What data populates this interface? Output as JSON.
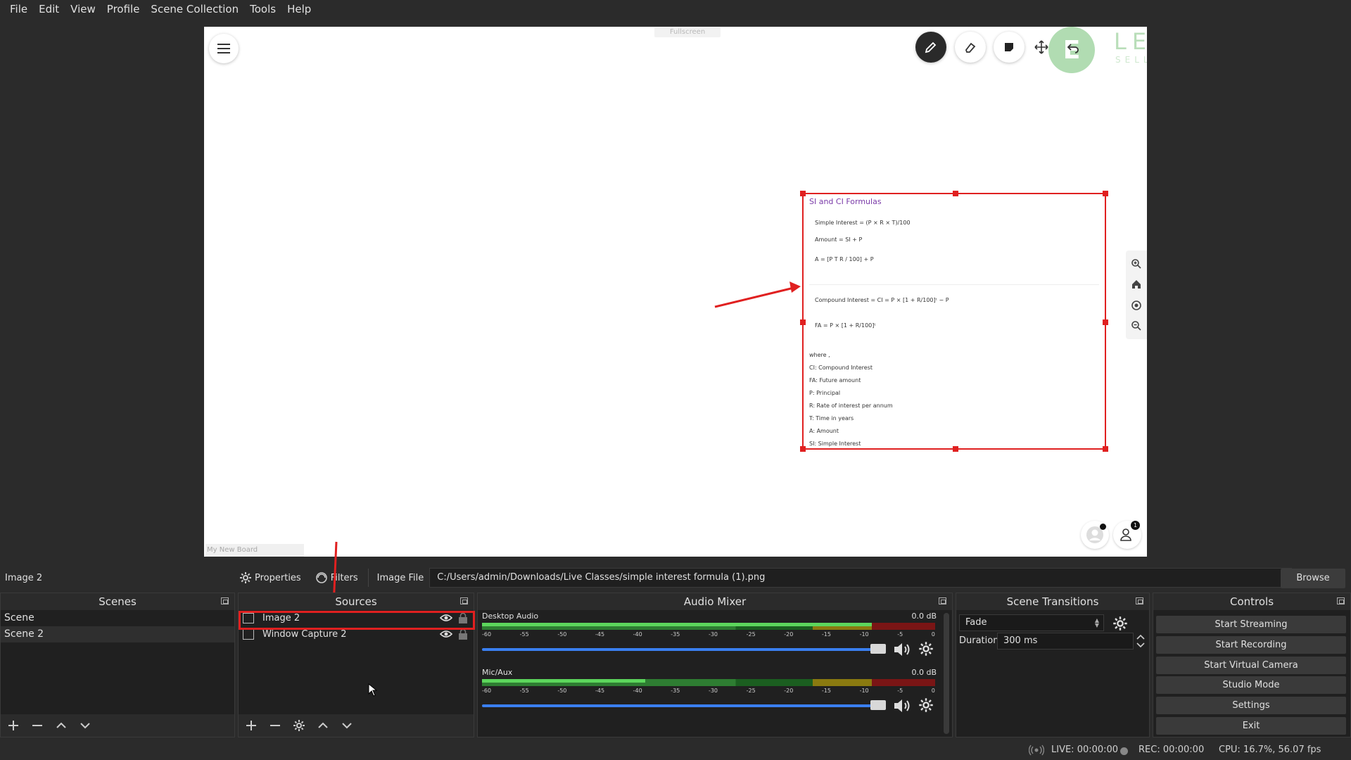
{
  "menu": [
    "File",
    "Edit",
    "View",
    "Profile",
    "Scene Collection",
    "Tools",
    "Help"
  ],
  "preview": {
    "fullscreen_label": "Fullscreen",
    "logo_letter": "E",
    "logo_word": "LEARNYST",
    "logo_sub": "SELL COURSES ONLINE",
    "board_name": "My New Board",
    "participant_count": "1",
    "formula": {
      "title": "SI and CI Formulas",
      "lines": [
        "Simple Interest = (P × R × T)/100",
        "Amount = SI + P",
        "A = [P T R / 100] + P",
        "Compound Interest = CI = P × [1 + R/100]ᵗ − P",
        "FA = P × [1 + R/100]ᵗ"
      ],
      "where": "where ,",
      "legend": [
        "CI: Compound Interest",
        "FA: Future amount",
        "P: Principal",
        "R: Rate of interest per annum",
        "T: Time in years",
        "A: Amount",
        "SI: Simple Interest"
      ]
    }
  },
  "propbar": {
    "selected_source": "Image 2",
    "properties_label": "Properties",
    "filters_label": "Filters",
    "image_file_label": "Image File",
    "path": "C:/Users/admin/Downloads/Live Classes/simple interest formula (1).png",
    "browse_label": "Browse"
  },
  "scenes": {
    "title": "Scenes",
    "items": [
      "Scene",
      "Scene 2"
    ]
  },
  "sources": {
    "title": "Sources",
    "items": [
      "Image 2",
      "Window Capture 2"
    ]
  },
  "mixer": {
    "title": "Audio Mixer",
    "channels": [
      {
        "name": "Desktop Audio",
        "db": "0.0 dB"
      },
      {
        "name": "Mic/Aux",
        "db": "0.0 dB"
      }
    ],
    "ticks": [
      "-60",
      "-55",
      "-50",
      "-45",
      "-40",
      "-35",
      "-30",
      "-25",
      "-20",
      "-15",
      "-10",
      "-5",
      "0"
    ]
  },
  "transitions": {
    "title": "Scene Transitions",
    "selected": "Fade",
    "duration_label": "Duration",
    "duration_value": "300 ms"
  },
  "controls": {
    "title": "Controls",
    "buttons": [
      "Start Streaming",
      "Start Recording",
      "Start Virtual Camera",
      "Studio Mode",
      "Settings",
      "Exit"
    ]
  },
  "status": {
    "live": "LIVE: 00:00:00",
    "rec": "REC: 00:00:00",
    "cpu": "CPU: 16.7%, 56.07 fps"
  },
  "colors": {
    "accent_red": "#e02020",
    "slider_blue": "#3a7ff0",
    "formula_title": "#7a3aa8"
  }
}
